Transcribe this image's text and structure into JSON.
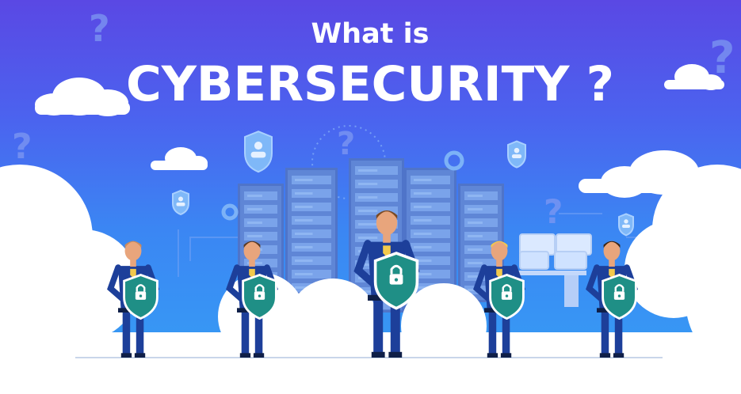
{
  "title": {
    "line1": "What is",
    "line2": "CYBERSECURITY ?"
  },
  "decor": {
    "question_mark": "?"
  },
  "colors": {
    "bg_top": "#5a48e4",
    "bg_bottom": "#35a0f5",
    "cloud": "#ffffff",
    "server_body": "#5f86d6",
    "server_light": "#8fb6f2",
    "suit": "#1d3f9a",
    "shield": "#1f8f86",
    "skin": "#e8a57c"
  },
  "icons": [
    "question-mark-icon",
    "cloud-icon",
    "server-rack-icon",
    "shield-lock-icon",
    "user-shield-icon",
    "monitor-icon",
    "gear-icon"
  ]
}
